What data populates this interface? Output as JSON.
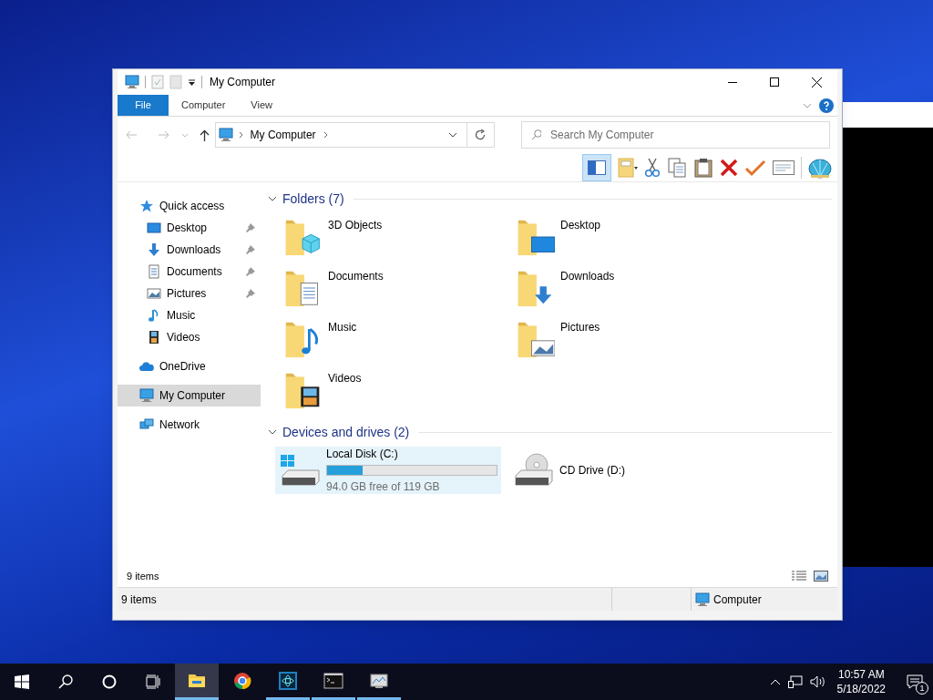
{
  "window": {
    "title": "My Computer"
  },
  "ribbon_tabs": [
    {
      "label": "File",
      "kind": "file"
    },
    {
      "label": "Computer",
      "kind": "tab"
    },
    {
      "label": "View",
      "kind": "tab"
    }
  ],
  "address": {
    "path": "My Computer"
  },
  "search": {
    "placeholder": "Search My Computer"
  },
  "nav": [
    {
      "label": "Quick access",
      "kind": "star",
      "selected": false,
      "children": [
        {
          "label": "Desktop",
          "kind": "desktop",
          "pinned": true,
          "selected": false
        },
        {
          "label": "Downloads",
          "kind": "downloads",
          "pinned": true,
          "selected": false
        },
        {
          "label": "Documents",
          "kind": "documents",
          "pinned": true,
          "selected": false
        },
        {
          "label": "Pictures",
          "kind": "pictures",
          "pinned": true,
          "selected": false
        },
        {
          "label": "Music",
          "kind": "music",
          "pinned": false,
          "selected": false
        },
        {
          "label": "Videos",
          "kind": "videos",
          "pinned": false,
          "selected": false
        }
      ]
    },
    {
      "label": "OneDrive",
      "kind": "cloud",
      "selected": false
    },
    {
      "label": "My Computer",
      "kind": "computer",
      "selected": true
    },
    {
      "label": "Network",
      "kind": "network",
      "selected": false
    }
  ],
  "folders": {
    "title": "Folders (7)",
    "items": [
      {
        "label": "3D Objects",
        "kind": "cube"
      },
      {
        "label": "Desktop",
        "kind": "desktop"
      },
      {
        "label": "Documents",
        "kind": "documents"
      },
      {
        "label": "Downloads",
        "kind": "downloads"
      },
      {
        "label": "Music",
        "kind": "music"
      },
      {
        "label": "Pictures",
        "kind": "pictures"
      },
      {
        "label": "Videos",
        "kind": "videos"
      }
    ]
  },
  "drives": {
    "title": "Devices and drives (2)",
    "items": [
      {
        "label": "Local Disk (C:)",
        "kind": "disk",
        "selected": true,
        "level": 0.21,
        "free": "94.0 GB free of 119 GB"
      },
      {
        "label": "CD Drive (D:)",
        "kind": "cd",
        "selected": false
      }
    ]
  },
  "item_count": "9 items",
  "status_bar": {
    "left": "9 items",
    "right": "Computer"
  },
  "taskbar": {
    "apps": [
      {
        "kind": "explorer",
        "active": true,
        "running": true
      },
      {
        "kind": "chrome",
        "active": false,
        "running": false
      },
      {
        "kind": "atom",
        "active": false,
        "running": true
      },
      {
        "kind": "terminal",
        "active": false,
        "running": true
      },
      {
        "kind": "monitor",
        "active": false,
        "running": true
      }
    ],
    "time": "10:57 AM",
    "date": "5/18/2022",
    "notifications": "1"
  }
}
